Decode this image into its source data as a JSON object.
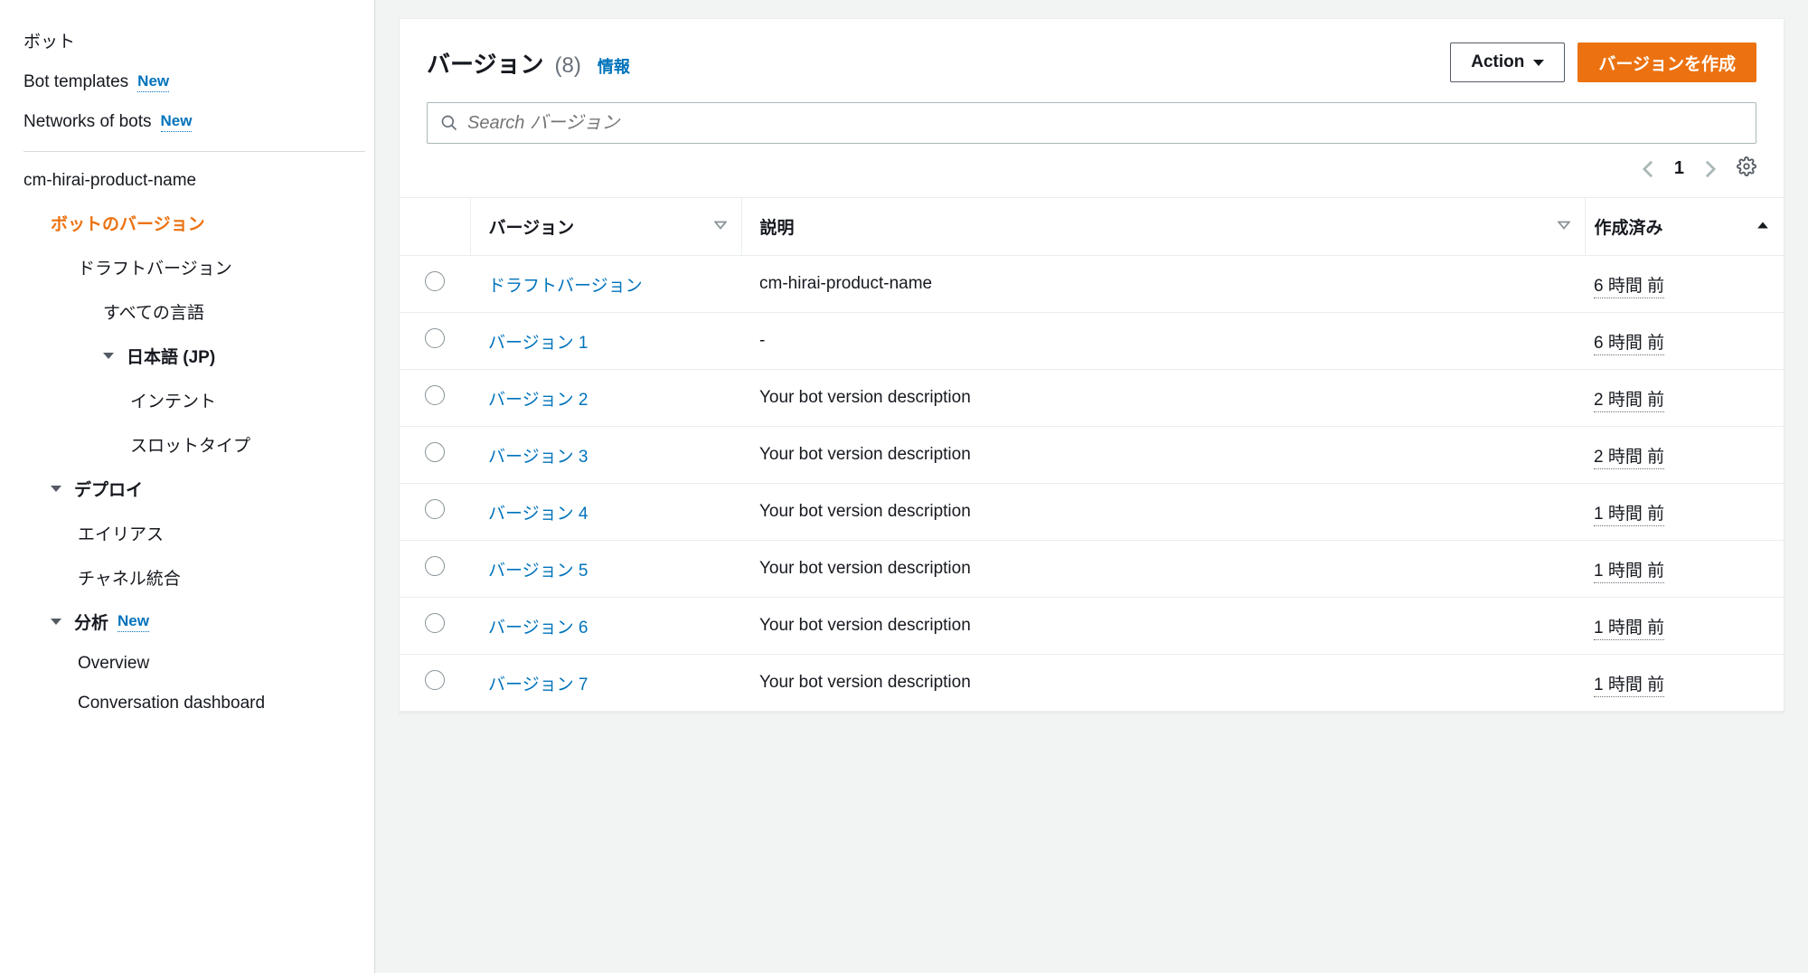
{
  "sidebar": {
    "top": [
      {
        "label": "ボット",
        "badge": "",
        "k": "bots"
      },
      {
        "label": "Bot templates",
        "badge": "New",
        "k": "bot-templates"
      },
      {
        "label": "Networks of bots",
        "badge": "New",
        "k": "networks"
      }
    ],
    "botName": "cm-hirai-product-name",
    "tree": [
      {
        "label": "ボットのバージョン",
        "active": true,
        "indent": 1,
        "caret": false,
        "k": "bot-versions"
      },
      {
        "label": "ドラフトバージョン",
        "indent": 2,
        "caret": false,
        "k": "draft-version"
      },
      {
        "label": "すべての言語",
        "indent": 3,
        "caret": false,
        "k": "all-langs"
      },
      {
        "label": "日本語 (JP)",
        "indent": 3,
        "caret": true,
        "bold": true,
        "k": "lang-jp"
      },
      {
        "label": "インテント",
        "indent": 4,
        "caret": false,
        "k": "intents"
      },
      {
        "label": "スロットタイプ",
        "indent": 4,
        "caret": false,
        "k": "slot-types"
      },
      {
        "label": "デプロイ",
        "indent": 1,
        "caret": true,
        "bold": true,
        "k": "deploy"
      },
      {
        "label": "エイリアス",
        "indent": 2,
        "caret": false,
        "k": "aliases"
      },
      {
        "label": "チャネル統合",
        "indent": 2,
        "caret": false,
        "k": "channels"
      },
      {
        "label": "分析",
        "indent": 1,
        "caret": true,
        "bold": true,
        "badge": "New",
        "k": "analytics"
      },
      {
        "label": "Overview",
        "indent": 2,
        "caret": false,
        "k": "overview"
      },
      {
        "label": "Conversation dashboard",
        "indent": 2,
        "caret": false,
        "k": "conv-dash"
      }
    ]
  },
  "header": {
    "title": "バージョン",
    "count": "(8)",
    "info": "情報",
    "action": "Action",
    "create": "バージョンを作成"
  },
  "search": {
    "placeholder": "Search バージョン"
  },
  "pager": {
    "page": "1"
  },
  "table": {
    "headers": {
      "version": "バージョン",
      "desc": "説明",
      "created": "作成済み"
    },
    "rows": [
      {
        "version": "ドラフトバージョン",
        "desc": "cm-hirai-product-name",
        "time": "6 時間 前"
      },
      {
        "version": "バージョン 1",
        "desc": "-",
        "time": "6 時間 前"
      },
      {
        "version": "バージョン 2",
        "desc": "Your bot version description",
        "time": "2 時間 前"
      },
      {
        "version": "バージョン 3",
        "desc": "Your bot version description",
        "time": "2 時間 前"
      },
      {
        "version": "バージョン 4",
        "desc": "Your bot version description",
        "time": "1 時間 前"
      },
      {
        "version": "バージョン 5",
        "desc": "Your bot version description",
        "time": "1 時間 前"
      },
      {
        "version": "バージョン 6",
        "desc": "Your bot version description",
        "time": "1 時間 前"
      },
      {
        "version": "バージョン 7",
        "desc": "Your bot version description",
        "time": "1 時間 前"
      }
    ]
  }
}
